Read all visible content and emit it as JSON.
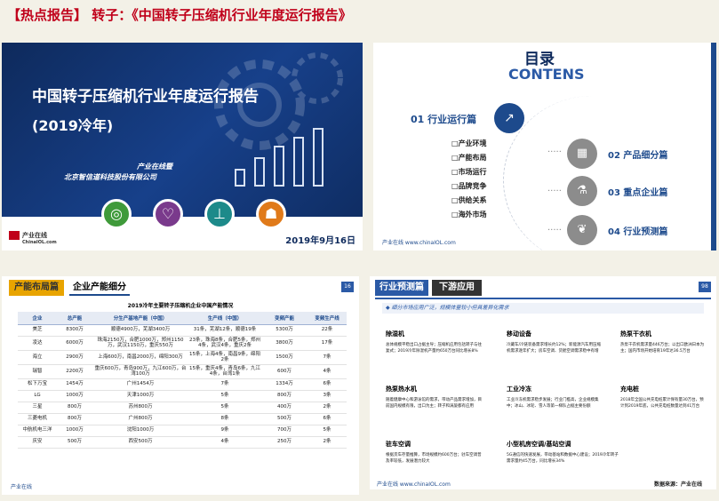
{
  "headline": "【热点报告】 转子：《中国转子压缩机行业年度运行报告》",
  "cover": {
    "title": "中国转子压缩机行业年度运行报告",
    "year": "(2019冷年)",
    "org_line1": "产业在线暨",
    "org_line2": "北京智信道科技股份有限公司",
    "logo_text": "产业在线",
    "logo_sub": "ChinaIOL.com",
    "date": "2019年9月16日",
    "icons": [
      "target-icon",
      "handshake-icon",
      "signpost-icon",
      "people-icon"
    ],
    "bar_levels": [
      0.3,
      0.5,
      0.7,
      0.85,
      1.0
    ]
  },
  "contents": {
    "title_cn": "目录",
    "title_en": "CONTENS",
    "section1": "01 行业运行篇",
    "section1_items": [
      "产业环境",
      "产能布局",
      "市场运行",
      "品牌竞争",
      "供给关系",
      "海外市场"
    ],
    "sections": [
      {
        "label": "02 产品细分篇",
        "icon": "grid-icon"
      },
      {
        "label": "03 重点企业篇",
        "icon": "flask-icon"
      },
      {
        "label": "04 行业预测篇",
        "icon": "leaf-icon"
      }
    ],
    "footer": "产业在线 www.chinaIOL.com"
  },
  "capacity": {
    "tag": "产能布局篇",
    "subtag": "企业产能细分",
    "page": "16",
    "table_title": "2019冷年主要转子压缩机企业中国产能情况",
    "columns": [
      "企业",
      "总产能",
      "分生产基地产能（中国）",
      "生产线（中国）",
      "变频产能",
      "变频生产线"
    ],
    "rows": [
      [
        "美芝",
        "8300万",
        "顺德4900万，芜湖3400万",
        "31条，芜湖12条，顺德19条",
        "5300万",
        "22条"
      ],
      [
        "凌达",
        "6000万",
        "珠海2150万，合肥1000万，郑州1150万，武汉1150万，重庆550万",
        "23条，珠海8条，合肥5条，郑州4条，武汉4条，重庆2条",
        "3800万",
        "17条"
      ],
      [
        "海立",
        "2900万",
        "上海600万，南昌2000万，绵阳300万",
        "15条，上海4条，南昌9条，绵阳2条",
        "1500万",
        "7条"
      ],
      [
        "瑞智",
        "2200万",
        "重庆600万，青岛900万，九江600万，台湾100万",
        "15条，重庆4条，青岛6条，九江4条，台湾1条",
        "600万",
        "4条"
      ],
      [
        "松下万宝",
        "1454万",
        "广州1454万",
        "7条",
        "1334万",
        "6条"
      ],
      [
        "LG",
        "1000万",
        "天津1000万",
        "5条",
        "800万",
        "3条"
      ],
      [
        "三星",
        "800万",
        "苏州800万",
        "5条",
        "400万",
        "2条"
      ],
      [
        "三菱电机",
        "800万",
        "广州800万",
        "8条",
        "500万",
        "6条"
      ],
      [
        "中航机电三洋",
        "1000万",
        "沈阳1000万",
        "9条",
        "700万",
        "5条"
      ],
      [
        "庆安",
        "500万",
        "西安500万",
        "4条",
        "250万",
        "2条"
      ]
    ],
    "footer": "产业在线"
  },
  "forecast": {
    "tag": "行业预测篇",
    "subtag": "下游应用",
    "page": "98",
    "lead": "◆ 细分市场应用广泛，规模体量较小但具差异化需求",
    "cells": [
      {
        "h": "除湿机",
        "t": "总体规模平稳出口占据主导；压缩机应用包括转子与往复式；2019冷年除湿机产量约650万台同比增长8%"
      },
      {
        "h": "移动设备",
        "t": "冷藏车/冷链装备需求增长约12%；新能源汽车用压缩机需求逐年扩大；房车空调、货舱空调需求稳中有增"
      },
      {
        "h": "热泵干衣机",
        "t": "热泵干衣机需求量446万台；以出口欧洲日本为主；国内市场开始培育19年达36.5万台"
      },
      {
        "h": "热泵热水机",
        "t": "随着健康中心和游泳馆的需求，带动产品需求增加，目前国内规模有限，出口为主；转子和涡旋都有应用"
      },
      {
        "h": "工业冷冻",
        "t": "工业冷冻机需求稳步发展；行业门槛高，企业规模集中；冰山、冰轮、雪人等第一梯队占据主要份额"
      },
      {
        "h": "充电桩",
        "t": "2018年全国公共充电桩累计保有量30万台，预计到2019年底，公共充电桩数量达到41万台"
      },
      {
        "h": "驻车空调",
        "t": "根据货车存量推算，市场规模约600万台；驻车空调普及率较低，发展潜力较大"
      },
      {
        "h": "小型机房空调/基站空调",
        "t": "5G通信的快速发展，带动基站和数据中心建设；2019冷年转子需求量约45万台，同比增长34%"
      }
    ],
    "footer": "产业在线 www.chinaIOL.com",
    "source": "数据来源：产业在线"
  }
}
